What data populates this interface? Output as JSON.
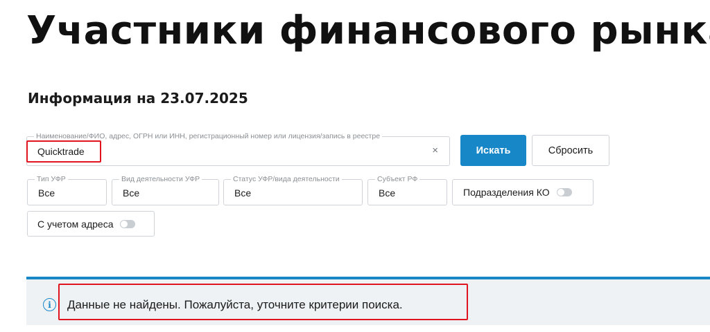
{
  "page": {
    "title": "Участники финансового рынка",
    "info_date": "Информация на 23.07.2025"
  },
  "search": {
    "legend": "Наименование/ФИО, адрес, ОГРН или ИНН, регистрационный номер или лицензия/запись в реестре",
    "value": "Quicktrade",
    "clear_icon": "×",
    "search_button": "Искать",
    "reset_button": "Сбросить"
  },
  "filters": [
    {
      "legend": "Тип УФР",
      "value": "Все"
    },
    {
      "legend": "Вид деятельности УФР",
      "value": "Все"
    },
    {
      "legend": "Статус УФР/вида деятельности",
      "value": "Все"
    },
    {
      "legend": "Субъект РФ",
      "value": "Все"
    }
  ],
  "toggles": {
    "ko_divisions": {
      "label": "Подразделения КО",
      "enabled": false
    },
    "with_address": {
      "label": "С учетом адреса",
      "enabled": false
    }
  },
  "notice": {
    "icon": "info-icon",
    "text": "Данные не найдены. Пожалуйста, уточните критерии поиска."
  },
  "colors": {
    "accent": "#1787c8",
    "highlight": "#e0141e",
    "notice_bg": "#eef2f4"
  }
}
